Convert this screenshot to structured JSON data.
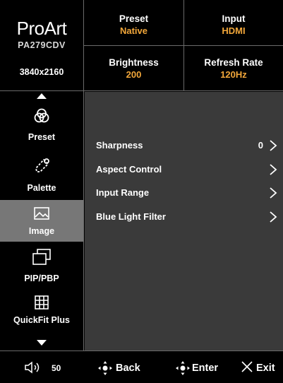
{
  "brand": {
    "logo": "ProArt",
    "model": "PA279CDV",
    "resolution": "3840x2160"
  },
  "status": {
    "preset": {
      "label": "Preset",
      "value": "Native"
    },
    "input": {
      "label": "Input",
      "value": "HDMI"
    },
    "brightness": {
      "label": "Brightness",
      "value": "200"
    },
    "refresh": {
      "label": "Refresh Rate",
      "value": "120Hz"
    }
  },
  "sidebar": {
    "items": [
      {
        "label": "Preset",
        "icon": "preset-icon"
      },
      {
        "label": "Palette",
        "icon": "palette-icon"
      },
      {
        "label": "Image",
        "icon": "image-icon",
        "active": true
      },
      {
        "label": "PIP/PBP",
        "icon": "pip-pbp-icon"
      },
      {
        "label": "QuickFit Plus",
        "icon": "quickfit-icon"
      }
    ]
  },
  "menu": {
    "rows": [
      {
        "label": "Sharpness",
        "value": "0"
      },
      {
        "label": "Aspect Control",
        "value": ""
      },
      {
        "label": "Input Range",
        "value": ""
      },
      {
        "label": "Blue Light Filter",
        "value": ""
      }
    ]
  },
  "bottom": {
    "volume": "50",
    "back": "Back",
    "enter": "Enter",
    "exit": "Exit"
  },
  "colors": {
    "accent_value": "#f2a73a",
    "active_bg": "#777777",
    "panel_bg": "#3a3a3a"
  }
}
